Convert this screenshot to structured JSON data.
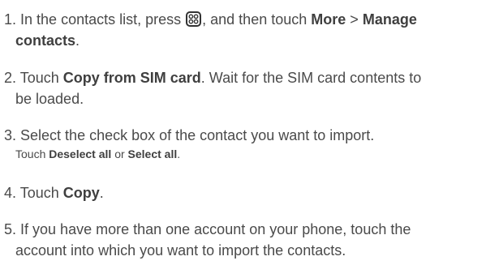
{
  "steps": [
    {
      "number": "1.",
      "text_a": "In the contacts list, press",
      "icon": "menu-key-icon",
      "text_b": ", and then touch",
      "bold_1": "More",
      "sep": ">",
      "bold_2": "Manage",
      "bold_2b": "contacts",
      "end": "."
    },
    {
      "number": "2.",
      "text_a": "Touch",
      "bold_1": "Copy from SIM card",
      "text_b": ". Wait for the SIM card contents to",
      "text_c": "be loaded."
    },
    {
      "number": "3.",
      "text_a": "Select the check box of the contact you want to import.",
      "sub_a": "Touch",
      "sub_bold_1": "Deselect all",
      "sub_or": "or",
      "sub_bold_2": "Select all",
      "sub_end": "."
    },
    {
      "number": "4.",
      "text_a": "Touch",
      "bold_1": "Copy",
      "end": "."
    },
    {
      "number": "5.",
      "text_a": "If you have more than one account on your phone, touch the",
      "text_b": "account into which you want to import the contacts."
    }
  ]
}
